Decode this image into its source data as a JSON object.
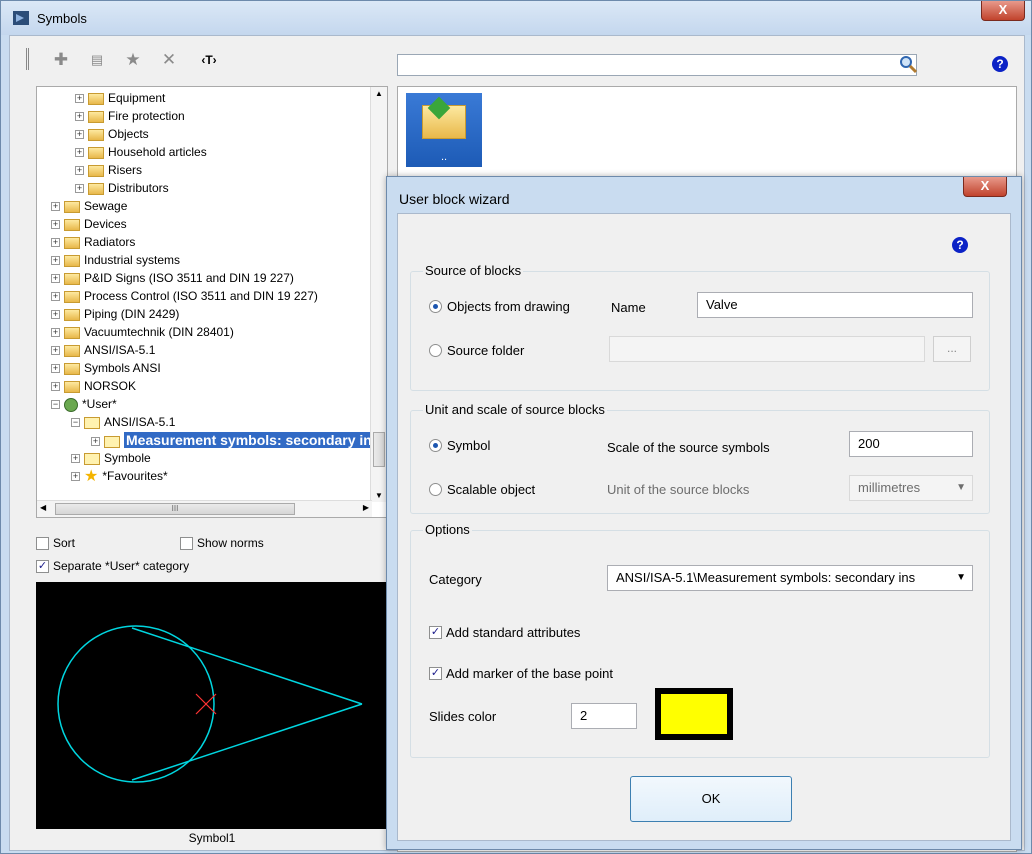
{
  "window": {
    "title": "Symbols",
    "close_label": "X"
  },
  "toolbar": {
    "search_value": "",
    "text_tool_label": "‹T›"
  },
  "tree": {
    "items": [
      {
        "label": "Equipment",
        "level": 3,
        "type": "folder"
      },
      {
        "label": "Fire protection",
        "level": 3,
        "type": "folder"
      },
      {
        "label": "Objects",
        "level": 3,
        "type": "folder"
      },
      {
        "label": "Household articles",
        "level": 3,
        "type": "folder"
      },
      {
        "label": "Risers",
        "level": 3,
        "type": "folder"
      },
      {
        "label": "Distributors",
        "level": 3,
        "type": "folder"
      },
      {
        "label": "Sewage",
        "level": 1,
        "type": "folder"
      },
      {
        "label": "Devices",
        "level": 1,
        "type": "folder"
      },
      {
        "label": "Radiators",
        "level": 1,
        "type": "folder"
      },
      {
        "label": "Industrial systems",
        "level": 1,
        "type": "folder"
      },
      {
        "label": "P&ID Signs (ISO 3511 and DIN 19 227)",
        "level": 1,
        "type": "folder"
      },
      {
        "label": "Process Control (ISO 3511 and DIN 19 227)",
        "level": 1,
        "type": "folder"
      },
      {
        "label": "Piping (DIN 2429)",
        "level": 1,
        "type": "folder"
      },
      {
        "label": "Vacuumtechnik (DIN 28401)",
        "level": 1,
        "type": "folder"
      },
      {
        "label": "ANSI/ISA-5.1",
        "level": 1,
        "type": "folder"
      },
      {
        "label": "Symbols ANSI",
        "level": 1,
        "type": "folder"
      },
      {
        "label": "NORSOK",
        "level": 1,
        "type": "folder"
      },
      {
        "label": "*User*",
        "level": 1,
        "type": "user"
      },
      {
        "label": "ANSI/ISA-5.1",
        "level": 2,
        "type": "folder"
      },
      {
        "label": "Measurement symbols: secondary in",
        "level": 3,
        "type": "selected"
      },
      {
        "label": "Symbole",
        "level": 2,
        "type": "folder"
      },
      {
        "label": "*Favourites*",
        "level": 2,
        "type": "star"
      }
    ],
    "hscroll_label": "III"
  },
  "options": {
    "sort_label": "Sort",
    "show_norms_label": "Show norms",
    "separate_user_label": "Separate *User* category"
  },
  "preview": {
    "label": "Symbol1"
  },
  "thumb": {
    "label": ".."
  },
  "dialog": {
    "title": "User block wizard",
    "close_label": "X",
    "source_group": {
      "title": "Source of blocks",
      "objects_label": "Objects from drawing",
      "name_label": "Name",
      "name_value": "Valve",
      "source_folder_label": "Source folder",
      "browse_label": "..."
    },
    "unit_group": {
      "title": "Unit and scale of source blocks",
      "symbol_label": "Symbol",
      "scale_label": "Scale of the source symbols",
      "scale_value": "200",
      "scalable_label": "Scalable object",
      "unit_label": "Unit of the source blocks",
      "unit_value": "millimetres"
    },
    "options_group": {
      "title": "Options",
      "category_label": "Category",
      "category_value": "ANSI/ISA-5.1\\Measurement symbols: secondary ins",
      "add_attributes_label": "Add standard attributes",
      "add_marker_label": "Add marker of the base point",
      "slides_color_label": "Slides color",
      "slides_color_value": "2",
      "slides_color_hex": "#ffff00"
    },
    "ok_label": "OK"
  },
  "colors": {
    "accent": "#316ac5",
    "preview_line": "#00d6e0",
    "marker": "#ff3333"
  }
}
